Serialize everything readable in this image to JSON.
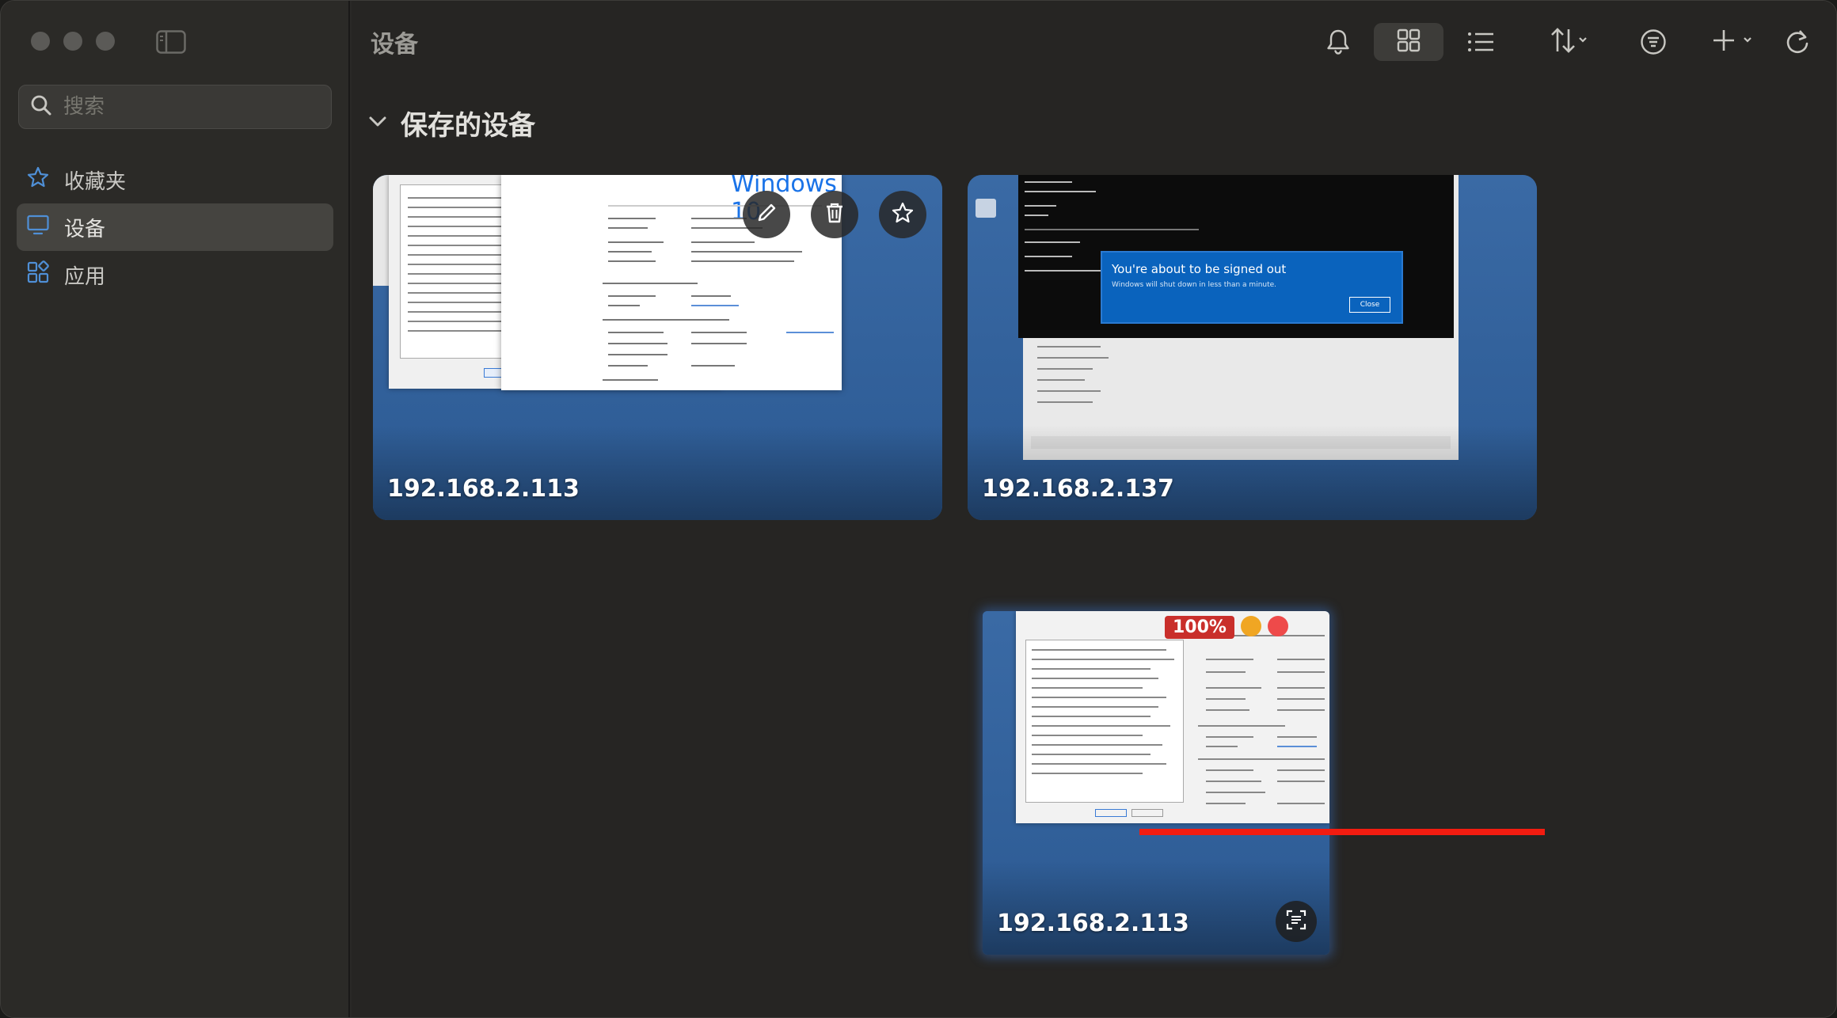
{
  "sidebar": {
    "search_placeholder": "搜索",
    "items": [
      {
        "label": "收藏夹",
        "icon": "star-icon",
        "active": false
      },
      {
        "label": "设备",
        "icon": "monitor-icon",
        "active": true
      },
      {
        "label": "应用",
        "icon": "apps-icon",
        "active": false
      }
    ]
  },
  "toolbar": {
    "title": "设备",
    "icons": [
      "bell-icon",
      "grid-view-icon",
      "list-view-icon",
      "sort-icon",
      "filter-icon",
      "add-icon",
      "refresh-icon"
    ]
  },
  "section": {
    "title": "保存的设备"
  },
  "devices": [
    {
      "label": "192.168.2.113"
    },
    {
      "label": "192.168.2.137",
      "dialog_title": "You're about to be signed out",
      "dialog_text": "Windows will shut down in less than a minute.",
      "dialog_button": "Close"
    },
    {
      "label": "192.168.2.113",
      "zoom": "100%"
    }
  ],
  "card1_window_text": "Windows 10",
  "colors": {
    "accent_red": "#f21c10",
    "desktop_blue": "#2c5c97"
  }
}
